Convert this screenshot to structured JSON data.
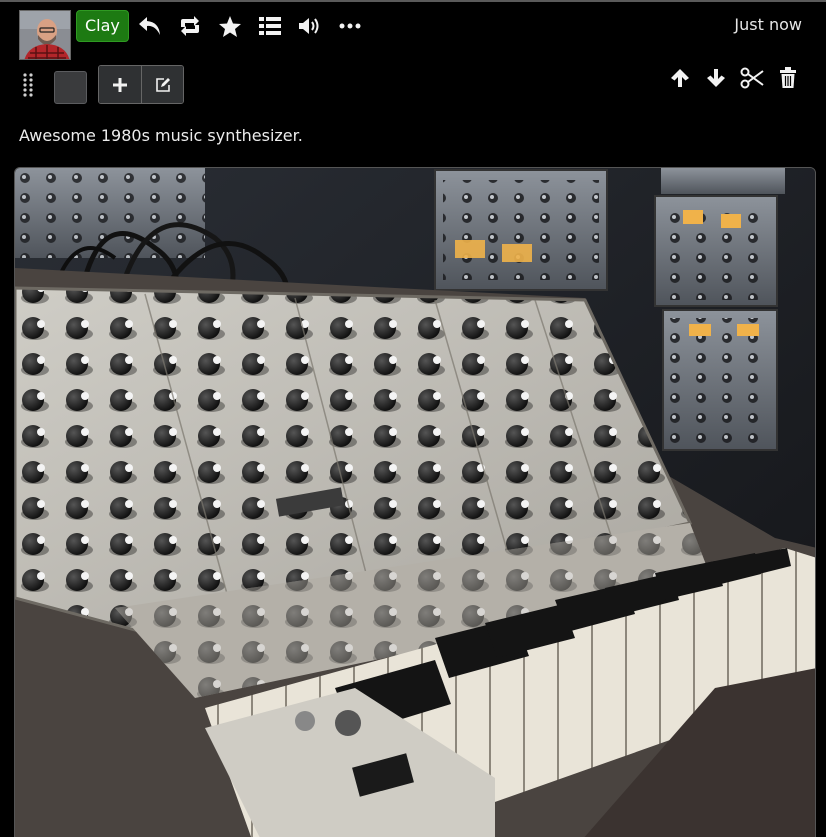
{
  "post": {
    "user": {
      "name": "Clay",
      "avatar_icon": "user-avatar"
    },
    "timestamp": "Just now",
    "text": "Awesome 1980s music synthesizer.",
    "image": {
      "icon": "synthesizer-photo"
    }
  },
  "icons": {
    "reply": "reply-icon",
    "repost": "repost-icon",
    "favorite": "star-icon",
    "list": "list-icon",
    "speak": "speaker-icon",
    "more": "more-icon",
    "drag": "drag-handle-icon",
    "add": "plus-icon",
    "edit": "edit-icon",
    "move_up": "arrow-up-icon",
    "move_down": "arrow-down-icon",
    "cut": "scissors-icon",
    "delete": "trash-icon"
  },
  "colors": {
    "user_button": "#1d7a12",
    "background": "#000000",
    "text": "#e8e8e8"
  }
}
